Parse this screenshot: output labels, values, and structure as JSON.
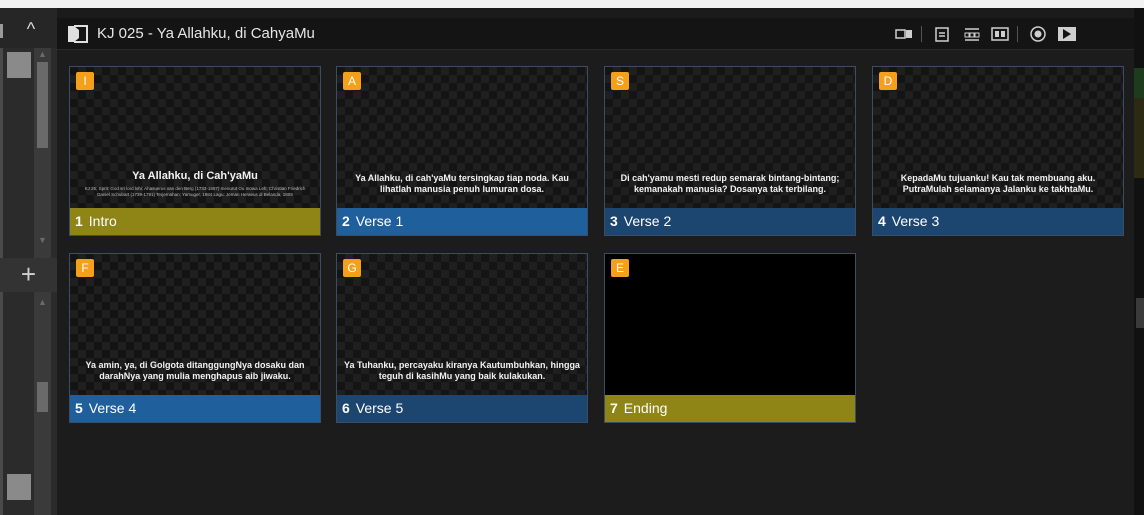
{
  "header": {
    "title": "KJ 025 - Ya Allahku, di CahyaMu"
  },
  "left_panel": {
    "collapse_glyph": "^",
    "add_glyph": "+"
  },
  "slides": [
    {
      "badge": "I",
      "number": "1",
      "label": "Intro",
      "color": "#8f8516",
      "lyric": "Ya Allahku, di Cah'yaMu",
      "credits": "KJ 25; Sprit: God sri lord lohi; Ahasuerus van den Berg (1733-1867) menurut Ou mowa Leh; Christian Friedrich Daniel Schubart (1739-1791) Terjemahan: Yamuger, 1984 Lagu: Jeman Heraeus di Belanda, 1809"
    },
    {
      "badge": "A",
      "number": "2",
      "label": "Verse 1",
      "color": "#1e5f9c",
      "lyric": "Ya Allahku, di cah'yaMu tersingkap tiap noda. Kau lihatlah manusia penuh lumuran dosa."
    },
    {
      "badge": "S",
      "number": "3",
      "label": "Verse 2",
      "color": "#1c4570",
      "lyric": "Di cah'yamu mesti redup semarak bintang-bintang; kemanakah manusia? Dosanya tak terbilang."
    },
    {
      "badge": "D",
      "number": "4",
      "label": "Verse 3",
      "color": "#1c4570",
      "lyric": "KepadaMu tujuanku! Kau tak membuang aku. PutraMulah selamanya Jalanku ke takhtaMu."
    },
    {
      "badge": "F",
      "number": "5",
      "label": "Verse 4",
      "color": "#1e5f9c",
      "lyric": "Ya amin, ya, di Golgota ditanggungNya dosaku dan darahNya yang mulia menghapus aib jiwaku."
    },
    {
      "badge": "G",
      "number": "6",
      "label": "Verse 5",
      "color": "#1c4570",
      "lyric": "Ya Tuhanku, percayaku kiranya Kautumbuhkan, hingga teguh di kasihMu yang baik kulakukan."
    },
    {
      "badge": "E",
      "number": "7",
      "label": "Ending",
      "color": "#8f8516",
      "lyric": ""
    }
  ]
}
